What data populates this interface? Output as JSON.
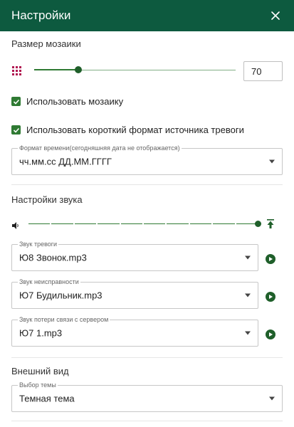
{
  "header": {
    "title": "Настройки",
    "close_icon": "close-icon"
  },
  "mosaic": {
    "title": "Размер мозаики",
    "value": "70",
    "slider_fraction": 0.22,
    "icon": "grid-icon",
    "icon_color": "#b0124f"
  },
  "checkboxes": {
    "use_mosaic": "Использовать мозаику",
    "short_alarm_source": "Использовать короткий формат источника тревоги"
  },
  "time_format": {
    "legend": "Формат времени(сегодняшняя дата не отображается)",
    "value": "чч.мм.сс ДД.ММ.ГГГГ"
  },
  "sound": {
    "title": "Настройки звука",
    "volume_fraction": 1.0,
    "volume_icon": "volume-icon",
    "max_icon": "volume-max-icon",
    "fields": [
      {
        "legend": "Звук тревоги",
        "value": "Ю8 Звонок.mp3"
      },
      {
        "legend": "Звук неисправности",
        "value": "Ю7 Будильник.mp3"
      },
      {
        "legend": "Звук потери связи с сервером",
        "value": "Ю7 1.mp3"
      }
    ]
  },
  "appearance": {
    "title": "Внешний вид",
    "theme_legend": "Выбор темы",
    "theme_value": "Темная тема"
  },
  "colors": {
    "header_bg": "#0d5a3f",
    "accent": "#2f7a33"
  }
}
